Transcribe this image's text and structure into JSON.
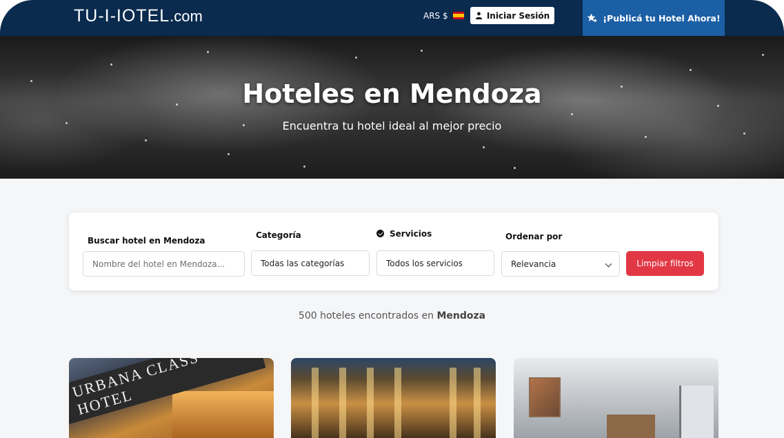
{
  "header": {
    "logo_brand": "TU-I-IOTEL",
    "logo_tld": ".com",
    "currency": "ARS $",
    "flag_icon": "spain-flag-icon",
    "login_label": "Iniciar Sesión",
    "publish_label": "¡Publicá tu Hotel Ahora!"
  },
  "hero": {
    "title": "Hoteles en Mendoza",
    "subtitle": "Encuentra tu hotel ideal al mejor precio"
  },
  "filters": {
    "search_label": "Buscar hotel en Mendoza",
    "search_placeholder": "Nombre del hotel en Mendoza...",
    "category_label": "Categoría",
    "category_value": "Todas las categorías",
    "services_label": "Servicios",
    "services_value": "Todos los servicios",
    "sort_label": "Ordenar por",
    "sort_value": "Relevancia",
    "clear_label": "Limpiar filtros"
  },
  "results": {
    "text": "500 hoteles encontrados en",
    "city": "Mendoza"
  },
  "hotels": [
    {
      "sign_text": "URBANA CLASS HOTEL"
    },
    {},
    {}
  ],
  "colors": {
    "header_bg": "#0a2b4e",
    "publish_bg": "#1b5fa5",
    "clear_button": "#e23744"
  }
}
